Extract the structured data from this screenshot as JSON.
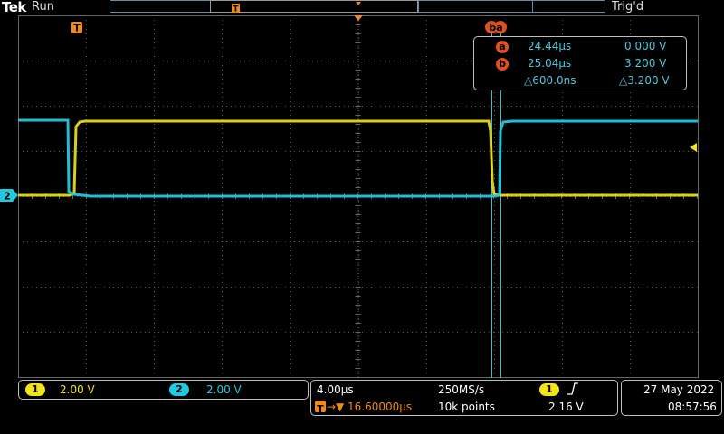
{
  "header": {
    "brand": "Tek",
    "status": "Run",
    "trigger_status": "Trig'd"
  },
  "markers": {
    "trigger_marker": "T",
    "cursor_pair_label": "ba",
    "channel2_marker": "2"
  },
  "cursor_readout": {
    "a_label": "a",
    "a_time": "24.44µs",
    "a_voltage": "0.000 V",
    "b_label": "b",
    "b_time": "25.04µs",
    "b_voltage": "3.200 V",
    "delta_time": "△600.0ns",
    "delta_voltage": "△3.200 V"
  },
  "channels": [
    {
      "number": "1",
      "scale": "2.00 V",
      "color": "#f2e41a"
    },
    {
      "number": "2",
      "scale": "2.00 V",
      "color": "#20c8e0"
    }
  ],
  "timebase": {
    "horizontal_scale": "4.00µs",
    "sample_rate": "250MS/s",
    "trigger_position": "16.60000µs",
    "record_length": "10k points",
    "trigger_source": "1",
    "trigger_slope_icon": "rising-edge-icon",
    "trigger_level": "2.16 V"
  },
  "datetime": {
    "date": "27 May 2022",
    "time": "08:57:56"
  },
  "colors": {
    "channel1": "#f2e41a",
    "channel2": "#20c8e0",
    "trigger_orange": "#f08a1c",
    "cursor_badge": "#e0501e",
    "grid": "#555555"
  }
}
